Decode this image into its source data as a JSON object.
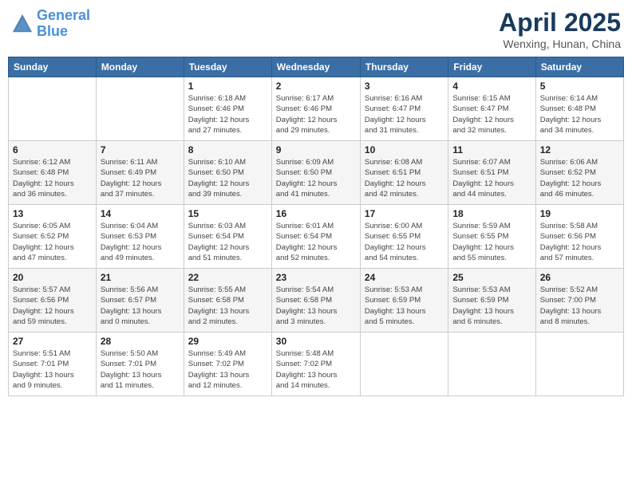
{
  "header": {
    "logo_line1": "General",
    "logo_line2": "Blue",
    "month": "April 2025",
    "location": "Wenxing, Hunan, China"
  },
  "days_of_week": [
    "Sunday",
    "Monday",
    "Tuesday",
    "Wednesday",
    "Thursday",
    "Friday",
    "Saturday"
  ],
  "weeks": [
    [
      {
        "day": "",
        "info": ""
      },
      {
        "day": "",
        "info": ""
      },
      {
        "day": "1",
        "info": "Sunrise: 6:18 AM\nSunset: 6:46 PM\nDaylight: 12 hours\nand 27 minutes."
      },
      {
        "day": "2",
        "info": "Sunrise: 6:17 AM\nSunset: 6:46 PM\nDaylight: 12 hours\nand 29 minutes."
      },
      {
        "day": "3",
        "info": "Sunrise: 6:16 AM\nSunset: 6:47 PM\nDaylight: 12 hours\nand 31 minutes."
      },
      {
        "day": "4",
        "info": "Sunrise: 6:15 AM\nSunset: 6:47 PM\nDaylight: 12 hours\nand 32 minutes."
      },
      {
        "day": "5",
        "info": "Sunrise: 6:14 AM\nSunset: 6:48 PM\nDaylight: 12 hours\nand 34 minutes."
      }
    ],
    [
      {
        "day": "6",
        "info": "Sunrise: 6:12 AM\nSunset: 6:48 PM\nDaylight: 12 hours\nand 36 minutes."
      },
      {
        "day": "7",
        "info": "Sunrise: 6:11 AM\nSunset: 6:49 PM\nDaylight: 12 hours\nand 37 minutes."
      },
      {
        "day": "8",
        "info": "Sunrise: 6:10 AM\nSunset: 6:50 PM\nDaylight: 12 hours\nand 39 minutes."
      },
      {
        "day": "9",
        "info": "Sunrise: 6:09 AM\nSunset: 6:50 PM\nDaylight: 12 hours\nand 41 minutes."
      },
      {
        "day": "10",
        "info": "Sunrise: 6:08 AM\nSunset: 6:51 PM\nDaylight: 12 hours\nand 42 minutes."
      },
      {
        "day": "11",
        "info": "Sunrise: 6:07 AM\nSunset: 6:51 PM\nDaylight: 12 hours\nand 44 minutes."
      },
      {
        "day": "12",
        "info": "Sunrise: 6:06 AM\nSunset: 6:52 PM\nDaylight: 12 hours\nand 46 minutes."
      }
    ],
    [
      {
        "day": "13",
        "info": "Sunrise: 6:05 AM\nSunset: 6:52 PM\nDaylight: 12 hours\nand 47 minutes."
      },
      {
        "day": "14",
        "info": "Sunrise: 6:04 AM\nSunset: 6:53 PM\nDaylight: 12 hours\nand 49 minutes."
      },
      {
        "day": "15",
        "info": "Sunrise: 6:03 AM\nSunset: 6:54 PM\nDaylight: 12 hours\nand 51 minutes."
      },
      {
        "day": "16",
        "info": "Sunrise: 6:01 AM\nSunset: 6:54 PM\nDaylight: 12 hours\nand 52 minutes."
      },
      {
        "day": "17",
        "info": "Sunrise: 6:00 AM\nSunset: 6:55 PM\nDaylight: 12 hours\nand 54 minutes."
      },
      {
        "day": "18",
        "info": "Sunrise: 5:59 AM\nSunset: 6:55 PM\nDaylight: 12 hours\nand 55 minutes."
      },
      {
        "day": "19",
        "info": "Sunrise: 5:58 AM\nSunset: 6:56 PM\nDaylight: 12 hours\nand 57 minutes."
      }
    ],
    [
      {
        "day": "20",
        "info": "Sunrise: 5:57 AM\nSunset: 6:56 PM\nDaylight: 12 hours\nand 59 minutes."
      },
      {
        "day": "21",
        "info": "Sunrise: 5:56 AM\nSunset: 6:57 PM\nDaylight: 13 hours\nand 0 minutes."
      },
      {
        "day": "22",
        "info": "Sunrise: 5:55 AM\nSunset: 6:58 PM\nDaylight: 13 hours\nand 2 minutes."
      },
      {
        "day": "23",
        "info": "Sunrise: 5:54 AM\nSunset: 6:58 PM\nDaylight: 13 hours\nand 3 minutes."
      },
      {
        "day": "24",
        "info": "Sunrise: 5:53 AM\nSunset: 6:59 PM\nDaylight: 13 hours\nand 5 minutes."
      },
      {
        "day": "25",
        "info": "Sunrise: 5:53 AM\nSunset: 6:59 PM\nDaylight: 13 hours\nand 6 minutes."
      },
      {
        "day": "26",
        "info": "Sunrise: 5:52 AM\nSunset: 7:00 PM\nDaylight: 13 hours\nand 8 minutes."
      }
    ],
    [
      {
        "day": "27",
        "info": "Sunrise: 5:51 AM\nSunset: 7:01 PM\nDaylight: 13 hours\nand 9 minutes."
      },
      {
        "day": "28",
        "info": "Sunrise: 5:50 AM\nSunset: 7:01 PM\nDaylight: 13 hours\nand 11 minutes."
      },
      {
        "day": "29",
        "info": "Sunrise: 5:49 AM\nSunset: 7:02 PM\nDaylight: 13 hours\nand 12 minutes."
      },
      {
        "day": "30",
        "info": "Sunrise: 5:48 AM\nSunset: 7:02 PM\nDaylight: 13 hours\nand 14 minutes."
      },
      {
        "day": "",
        "info": ""
      },
      {
        "day": "",
        "info": ""
      },
      {
        "day": "",
        "info": ""
      }
    ]
  ]
}
